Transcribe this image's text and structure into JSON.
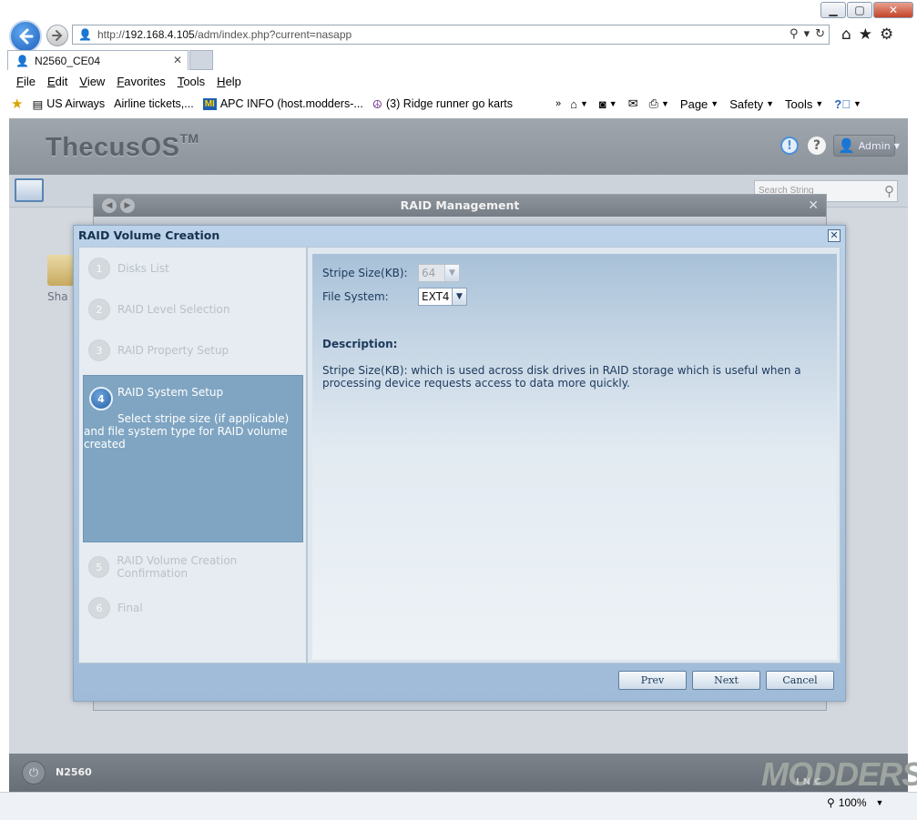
{
  "browser": {
    "url_prefix": "http://",
    "url_host": "192.168.4.105",
    "url_path": "/adm/index.php?current=nasapp",
    "tab_title": "N2560_CE04",
    "menu": [
      "File",
      "Edit",
      "View",
      "Favorites",
      "Tools",
      "Help"
    ],
    "favorites": [
      "US Airways",
      "Airline tickets,...",
      "APC INFO (host.modders-...",
      "(3) Ridge runner go karts"
    ],
    "favicon_apc": "MI",
    "commands": [
      "Page",
      "Safety",
      "Tools"
    ],
    "zoom": "100%"
  },
  "app": {
    "logo": "ThecusOS",
    "logo_tm": "TM",
    "user": "Admin",
    "search_placeholder": "Search String",
    "desktop_item_label": "Sha",
    "footer_host": "N2560",
    "watermark": "MODDERS",
    "watermark_sub": "INC"
  },
  "raid_management": {
    "title": "RAID Management"
  },
  "dialog": {
    "title": "RAID Volume Creation",
    "steps": [
      {
        "num": "1",
        "label": "Disks List"
      },
      {
        "num": "2",
        "label": "RAID Level Selection"
      },
      {
        "num": "3",
        "label": "RAID Property Setup"
      },
      {
        "num": "4",
        "label": "RAID System Setup",
        "description": "Select stripe size (if applicable) and file system type for RAID volume created"
      },
      {
        "num": "5",
        "label": "RAID Volume Creation Confirmation"
      },
      {
        "num": "6",
        "label": "Final"
      }
    ],
    "stripe_label": "Stripe Size(KB):",
    "stripe_value": "64",
    "fs_label": "File System:",
    "fs_value": "EXT4",
    "description_title": "Description:",
    "description_text": "Stripe Size(KB): which is used across disk drives in RAID storage which is useful when a processing device requests access to data more quickly.",
    "buttons": {
      "prev": "Prev",
      "next": "Next",
      "cancel": "Cancel"
    }
  },
  "colors": {
    "active_step": "#7fa5c2",
    "dialog_bg": "#bcd2e8",
    "header_bg": "#8c939b"
  }
}
